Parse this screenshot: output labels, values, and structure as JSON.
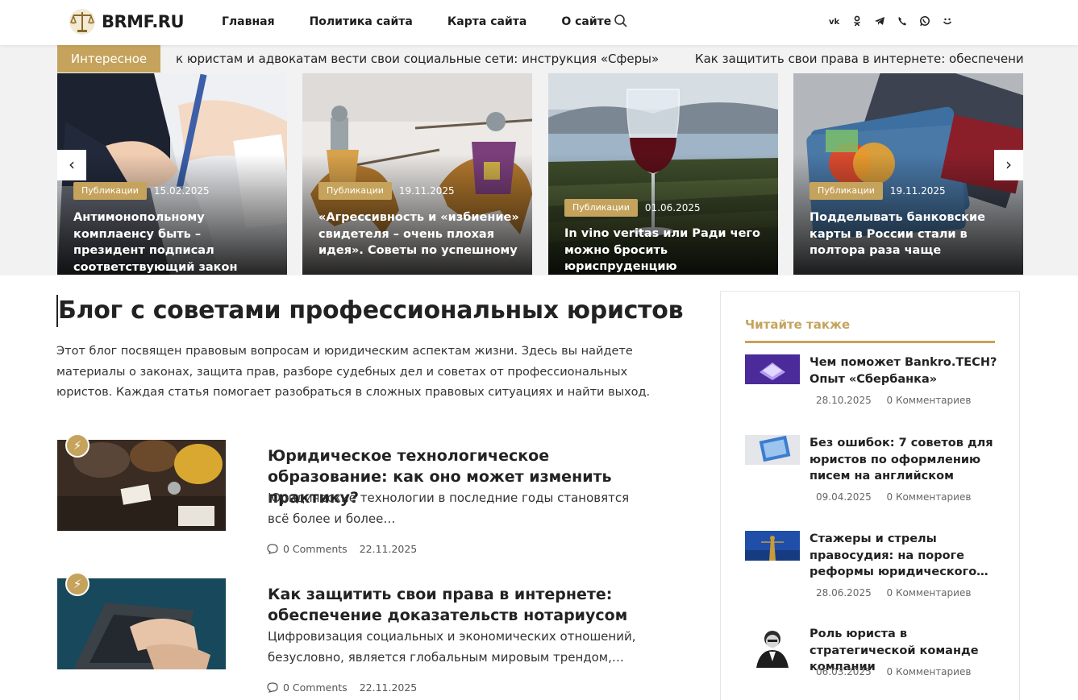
{
  "header": {
    "logo_text": "BRMF.RU",
    "nav": [
      "Главная",
      "Политика сайта",
      "Карта сайта",
      "О сайте"
    ],
    "social_icons": [
      "vk-icon",
      "odnoklassniki-icon",
      "telegram-icon",
      "viber-icon",
      "whatsapp-icon",
      "moimir-icon"
    ]
  },
  "ticker": {
    "label": "Интересное",
    "items": [
      "к юристам и адвокатам вести свои социальные сети: инструкция «Сферы»",
      "Как защитить свои права в интернете: обеспечение доказател"
    ]
  },
  "slider": {
    "prev_label": "‹",
    "next_label": "›",
    "cards": [
      {
        "badge": "Публикации",
        "date": "15.02.2025",
        "title": "Антимонопольному комплаенсу быть – президент подписал соответствующий закон"
      },
      {
        "badge": "Публикации",
        "date": "19.11.2025",
        "title": "«Агрессивность и «избиение» свидетеля – очень плохая идея». Советы по успешному"
      },
      {
        "badge": "Публикации",
        "date": "01.06.2025",
        "title": "In vino veritas или Ради чего можно бросить юриспруденцию"
      },
      {
        "badge": "Публикации",
        "date": "19.11.2025",
        "title": "Подделывать банковские карты в России стали в полтора раза чаще"
      }
    ]
  },
  "main": {
    "title": "Блог с советами профессиональных юристов",
    "intro": "Этот блог посвящен правовым вопросам и юридическим аспектам жизни. Здесь вы найдете материалы о законах, защита прав, разборе судебных дел и советах от профессиональных юристов. Каждая статья помогает разобраться в сложных правовых ситуациях и найти выход.",
    "posts": [
      {
        "title": "Юридическое технологическое образование: как оно может изменить практику?",
        "excerpt": "Юридические технологии в последние годы становятся всё более и более…",
        "comments": "0 Comments",
        "date": "22.11.2025"
      },
      {
        "title": "Как защитить свои права в интернете: обеспечение доказательств нотариусом",
        "excerpt": "Цифровизация социальных и экономических отношений, безусловно, является глобальным мировым трендом,…",
        "comments": "0 Comments",
        "date": "22.11.2025"
      }
    ]
  },
  "sidebar": {
    "heading": "Читайте также",
    "items": [
      {
        "title": "Чем поможет Bankro.TECH? Опыт «Сбербанка»",
        "date": "28.10.2025",
        "comments": "0 Комментариев"
      },
      {
        "title": "Без ошибок: 7 советов для юристов по оформлению писем на английском",
        "date": "09.04.2025",
        "comments": "0 Комментариев"
      },
      {
        "title": "Стажеры и стрелы правосудия: на пороге реформы юридического…",
        "date": "28.06.2025",
        "comments": "0 Комментариев"
      },
      {
        "title": "Роль юриста в стратегической команде компании",
        "date": "06.03.2025",
        "comments": "0 Комментариев"
      }
    ]
  },
  "colors": {
    "accent": "#c5a35c",
    "text": "#222222",
    "ticker_bg": "#f2f2f2"
  }
}
